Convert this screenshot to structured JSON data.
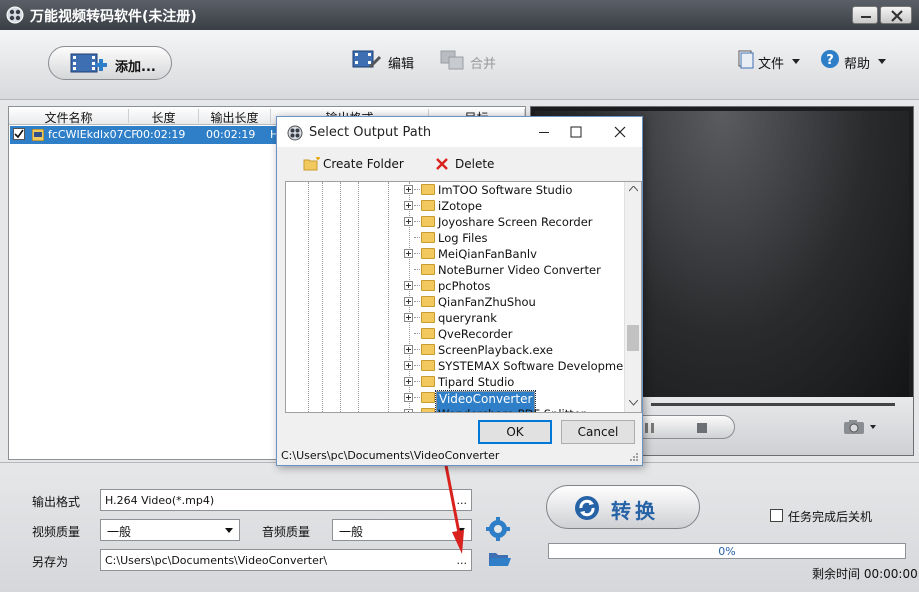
{
  "window": {
    "title": "万能视频转码软件(未注册)",
    "min_label": "minimize",
    "max_label": "maximize",
    "close_label": "close"
  },
  "toolbar": {
    "add_label": "添加...",
    "edit_label": "编辑",
    "merge_label": "合并",
    "file_label": "文件",
    "help_label": "帮助"
  },
  "filelist": {
    "columns": [
      "文件名称",
      "长度",
      "输出长度",
      "输出格式",
      "目标"
    ],
    "rows": [
      {
        "name": "fcCWIEkdlx07CF",
        "length": "00:02:19",
        "output_length": "00:02:19",
        "format": "H"
      }
    ]
  },
  "dialog": {
    "title": "Select Output Path",
    "create_folder": "Create Folder",
    "delete": "Delete",
    "folders": [
      {
        "name": "ImTOO Software Studio",
        "expandable": true
      },
      {
        "name": "iZotope",
        "expandable": true
      },
      {
        "name": "Joyoshare Screen Recorder",
        "expandable": true
      },
      {
        "name": "Log Files",
        "expandable": false
      },
      {
        "name": "MeiQianFanBanlv",
        "expandable": true
      },
      {
        "name": "NoteBurner Video Converter",
        "expandable": false
      },
      {
        "name": "pcPhotos",
        "expandable": true
      },
      {
        "name": "QianFanZhuShou",
        "expandable": true
      },
      {
        "name": "queryrank",
        "expandable": true
      },
      {
        "name": "QveRecorder",
        "expandable": false
      },
      {
        "name": "ScreenPlayback.exe",
        "expandable": true
      },
      {
        "name": "SYSTEMAX Software Development",
        "expandable": true
      },
      {
        "name": "Tipard Studio",
        "expandable": true
      },
      {
        "name": "VideoConverter",
        "expandable": true,
        "selected": true
      },
      {
        "name": "Wondershare PDF Splitter",
        "expandable": true
      }
    ],
    "ok_label": "OK",
    "cancel_label": "Cancel",
    "status_path": "C:\\Users\\pc\\Documents\\VideoConverter"
  },
  "bottom": {
    "output_format_label": "输出格式",
    "output_format_value": "H.264 Video(*.mp4)",
    "video_quality_label": "视频质量",
    "video_quality_value": "一般",
    "audio_quality_label": "音频质量",
    "audio_quality_value": "一般",
    "save_as_label": "另存为",
    "save_as_value": "C:\\Users\\pc\\Documents\\VideoConverter\\",
    "browse_dots": "...",
    "convert_label": "转换",
    "progress_text": "0%",
    "progress_value": 0,
    "shutdown_label": "任务完成后关机",
    "remaining_label": "剩余时间",
    "remaining_value": "00:00:00"
  },
  "colors": {
    "accent": "#2f7fc8",
    "convert_text": "#2663a6",
    "arrow": "#d9211d"
  }
}
